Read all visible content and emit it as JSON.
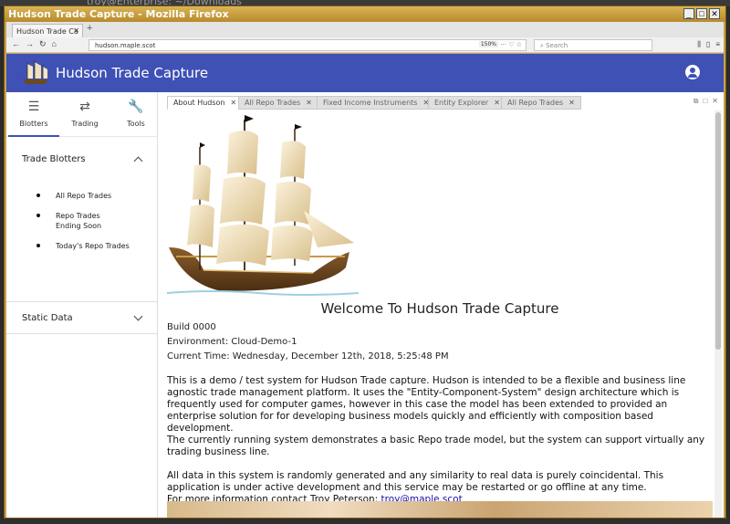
{
  "desktop": {
    "ghost_title": "troy@Enterprise: ~/Downloads"
  },
  "browser": {
    "window_title": "Hudson Trade Capture - Mozilla Firefox",
    "tab_label": "Hudson Trade Ca",
    "url": "hudson.maple.scot",
    "zoom": "150%",
    "search_placeholder": "Search"
  },
  "app": {
    "title": "Hudson Trade Capture",
    "sidebar_tabs": [
      {
        "label": "Blotters",
        "icon": "list-icon"
      },
      {
        "label": "Trading",
        "icon": "swap-icon"
      },
      {
        "label": "Tools",
        "icon": "wrench-icon"
      }
    ],
    "sections": {
      "trade_blotters": "Trade Blotters",
      "static_data": "Static Data"
    },
    "blotters": [
      "All Repo Trades",
      "Repo Trades Ending Soon",
      "Today's Repo Trades"
    ],
    "doc_tabs": [
      "About Hudson",
      "All Repo Trades",
      "Fixed Income Instruments",
      "Entity Explorer",
      "All Repo Trades"
    ],
    "about": {
      "welcome": "Welcome To Hudson Trade Capture",
      "build": "Build 0000",
      "environment": "Environment: Cloud-Demo-1",
      "current_time": "Current Time: Wednesday, December 12th, 2018, 5:25:48 PM",
      "para1": "This is a demo / test system for Hudson Trade capture. Hudson is intended to be a flexible and business line agnostic trade management platform. It uses the \"Entity-Component-System\" design architecture which is frequently used for computer games, however in this case the model has been extended to provided an enterprise solution for for developing business models quickly and efficiently with composition based development.",
      "para2": "The currently running system demonstrates a basic Repo trade model, but the system can support virtually any trading business line.",
      "para3": "All data in this system is randomly generated and any similarity to real data is purely coincidental. This application is under active development and this service may be restarted or go offline at any time.",
      "contact_prefix": "For more information contact Troy Peterson: ",
      "contact_email": "troy@maple.scot"
    }
  }
}
